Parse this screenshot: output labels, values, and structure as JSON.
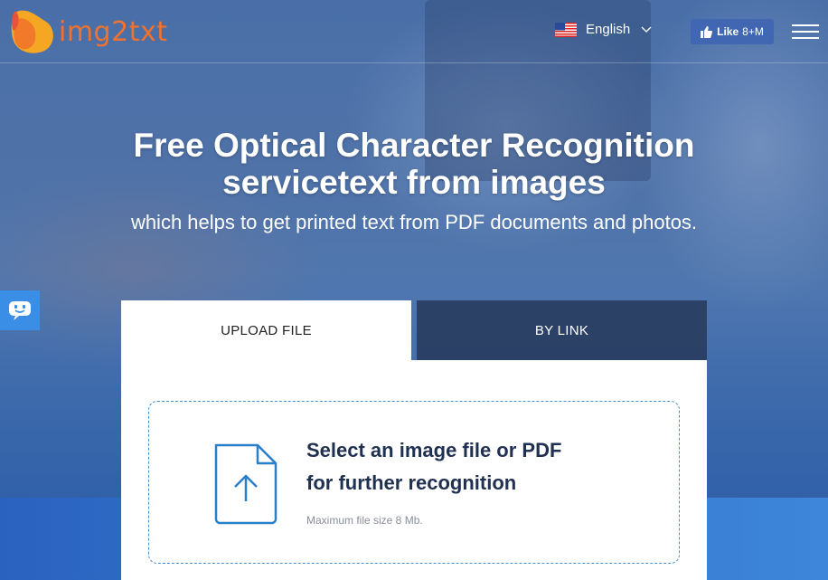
{
  "brand": {
    "name": "img2txt",
    "color": "#f0722e"
  },
  "header": {
    "language": {
      "label": "English",
      "flag": "us-flag-icon"
    },
    "facebook": {
      "like_label": "Like",
      "count": "8+M"
    },
    "menu_icon": "hamburger-menu-icon"
  },
  "hero": {
    "title_line1": "Free Optical Character Recognition",
    "title_line2": "servicetext from images",
    "subtitle": "which helps to get printed text from PDF documents and photos."
  },
  "chat": {
    "icon": "chat-bot-icon",
    "color": "#3b8ee6"
  },
  "upload": {
    "tabs": [
      {
        "label": "UPLOAD FILE",
        "active": true
      },
      {
        "label": "BY LINK",
        "active": false
      }
    ],
    "dropzone": {
      "title_line1": "Select an image file or PDF",
      "title_line2": "for further recognition",
      "note": "Maximum file size 8 Mb.",
      "icon": "file-upload-icon"
    }
  },
  "colors": {
    "accent": "#4a8fc9",
    "tab_inactive": "#283a5c",
    "facebook": "#4267b2"
  }
}
